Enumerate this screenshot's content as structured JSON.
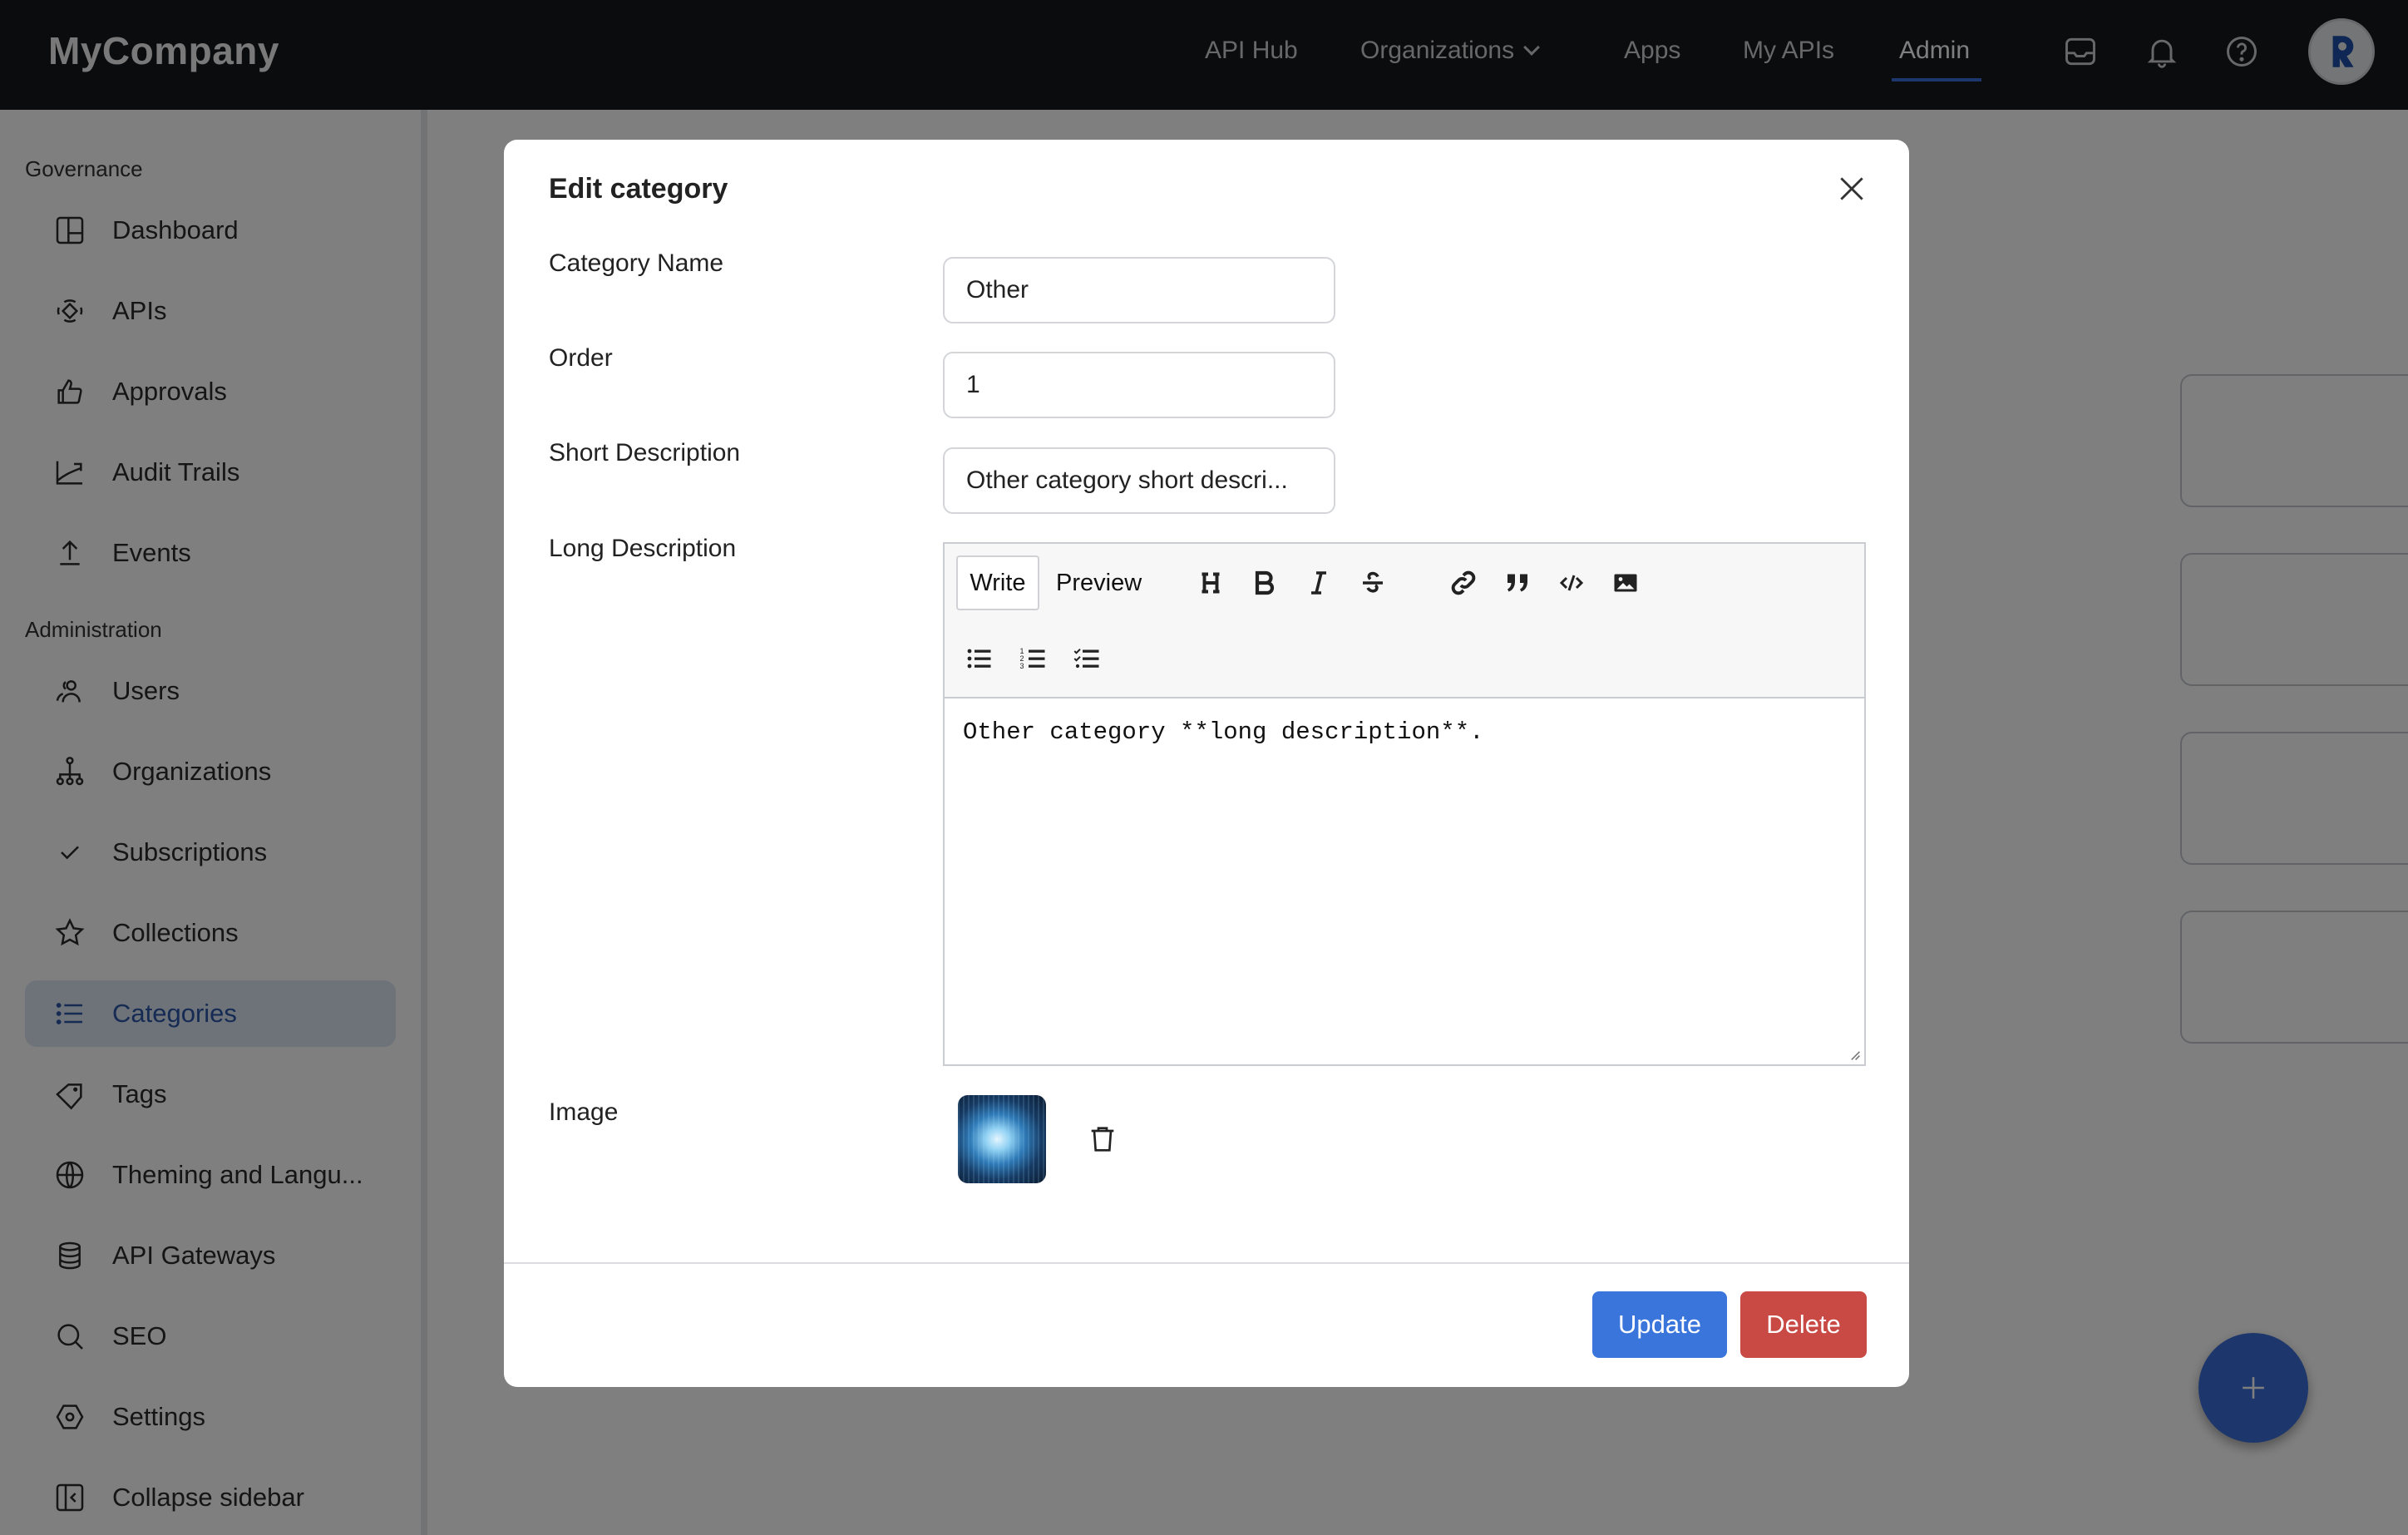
{
  "header": {
    "brand": "MyCompany",
    "nav": [
      {
        "label": "API Hub",
        "active": false
      },
      {
        "label": "Organizations",
        "active": false,
        "has_dropdown": true
      },
      {
        "label": "Apps",
        "active": false
      },
      {
        "label": "My APIs",
        "active": false
      },
      {
        "label": "Admin",
        "active": true
      }
    ],
    "icons": [
      "inbox-icon",
      "bell-icon",
      "help-icon"
    ],
    "accent_color": "#3a6fd8"
  },
  "sidebar": {
    "sections": [
      {
        "title": "Governance",
        "items": [
          {
            "label": "Dashboard",
            "icon": "dashboard-icon"
          },
          {
            "label": "APIs",
            "icon": "apis-icon"
          },
          {
            "label": "Approvals",
            "icon": "thumbs-up-icon"
          },
          {
            "label": "Audit Trails",
            "icon": "chart-line-icon"
          },
          {
            "label": "Events",
            "icon": "upload-icon"
          }
        ]
      },
      {
        "title": "Administration",
        "items": [
          {
            "label": "Users",
            "icon": "users-icon"
          },
          {
            "label": "Organizations",
            "icon": "org-tree-icon"
          },
          {
            "label": "Subscriptions",
            "icon": "check-icon"
          },
          {
            "label": "Collections",
            "icon": "star-icon"
          },
          {
            "label": "Categories",
            "icon": "list-icon",
            "active": true
          },
          {
            "label": "Tags",
            "icon": "tag-icon"
          },
          {
            "label": "Theming and Langu...",
            "icon": "globe-icon"
          },
          {
            "label": "API Gateways",
            "icon": "database-icon"
          },
          {
            "label": "SEO",
            "icon": "search-icon"
          },
          {
            "label": "Settings",
            "icon": "settings-icon"
          }
        ]
      }
    ],
    "collapse_label": "Collapse sidebar"
  },
  "modal": {
    "title": "Edit category",
    "fields": {
      "category_name": {
        "label": "Category Name",
        "value": "Other"
      },
      "order": {
        "label": "Order",
        "value": "1"
      },
      "short_description": {
        "label": "Short Description",
        "value": "Other category short descri..."
      },
      "long_description": {
        "label": "Long Description",
        "tabs": {
          "write": "Write",
          "preview": "Preview"
        },
        "active_tab": "Write",
        "toolbar": [
          "heading",
          "bold",
          "italic",
          "strikethrough",
          "link",
          "quote",
          "code",
          "image",
          "unordered-list",
          "ordered-list",
          "checked-list"
        ],
        "value": "Other category **long description**."
      },
      "image": {
        "label": "Image"
      }
    },
    "buttons": {
      "update": "Update",
      "delete": "Delete"
    },
    "colors": {
      "update": "#3a75dc",
      "delete": "#c94a45"
    }
  },
  "background": {
    "category_cards_count": 4,
    "fab_label": "+"
  }
}
